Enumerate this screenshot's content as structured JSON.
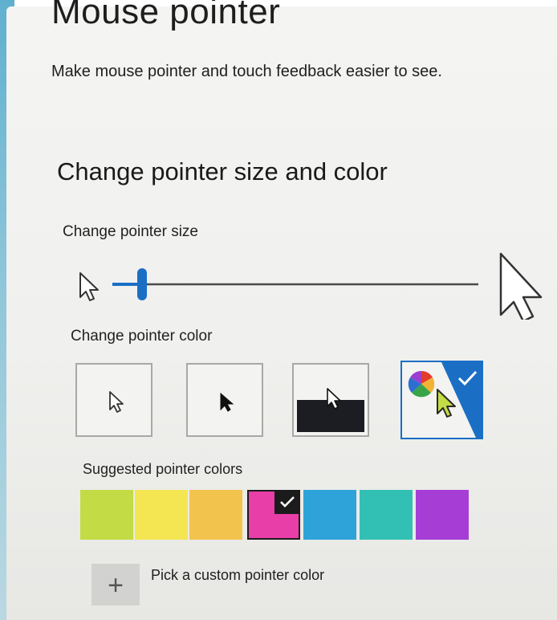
{
  "page": {
    "title": "Mouse pointer",
    "description": "Make mouse pointer and touch feedback easier to see."
  },
  "section": {
    "heading": "Change pointer size and color"
  },
  "pointer_size": {
    "label": "Change pointer size",
    "value_fraction": 0.07
  },
  "pointer_color": {
    "label": "Change pointer color",
    "options": [
      {
        "name": "White"
      },
      {
        "name": "Black"
      },
      {
        "name": "Inverted"
      },
      {
        "name": "Custom",
        "selected": true
      }
    ]
  },
  "suggested": {
    "label": "Suggested pointer colors",
    "colors": [
      "#c3dc45",
      "#f4e652",
      "#f2c34d",
      "#e83ea7",
      "#2ea3d9",
      "#33c0b4",
      "#a63ed6"
    ],
    "selected_index": 3
  },
  "custom": {
    "plus": "+",
    "label": "Pick a custom pointer color"
  },
  "colors": {
    "accent": "#1a6fc5",
    "slider_thumb": "#1a6fc5",
    "track": "#4a4a4a"
  }
}
